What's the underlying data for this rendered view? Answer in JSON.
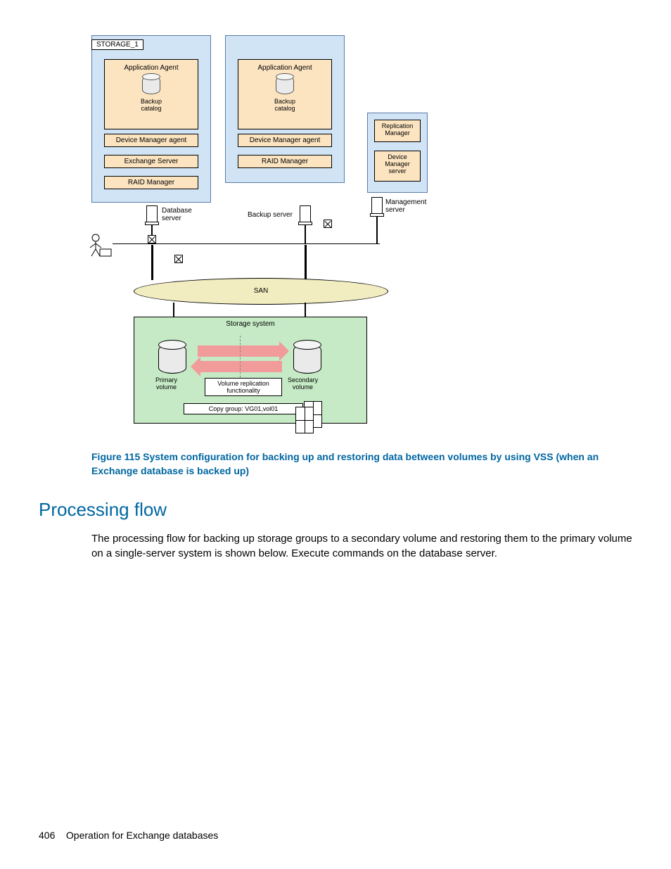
{
  "diagram": {
    "storage_tag": "STORAGE_1",
    "db_server": {
      "app_agent": "Application Agent",
      "catalog": "Backup\ncatalog",
      "dm_agent": "Device Manager agent",
      "exchange": "Exchange Server",
      "raid": "RAID Manager",
      "label": "Database\nserver"
    },
    "backup_server": {
      "app_agent": "Application Agent",
      "catalog": "Backup\ncatalog",
      "dm_agent": "Device Manager agent",
      "raid": "RAID Manager",
      "label": "Backup server"
    },
    "mgmt_server": {
      "rep_mgr": "Replication\nManager",
      "dm_server": "Device\nManager\nserver",
      "label": "Management\nserver"
    },
    "san": "SAN",
    "storage": {
      "title": "Storage system",
      "primary": "Primary\nvolume",
      "secondary": "Secondary\nvolume",
      "repl": "Volume replication\nfunctionality",
      "copy_group": "Copy group: VG01,vol01"
    }
  },
  "figure_caption": "Figure 115 System configuration for backing up and restoring data between volumes by using VSS (when an Exchange database is backed up)",
  "section_heading": "Processing flow",
  "body_paragraph": "The processing flow for backing up storage groups to a secondary volume and restoring them to the primary volume on a single-server system is shown below. Execute commands on the database server.",
  "footer": {
    "page": "406",
    "title": "Operation for Exchange databases"
  }
}
